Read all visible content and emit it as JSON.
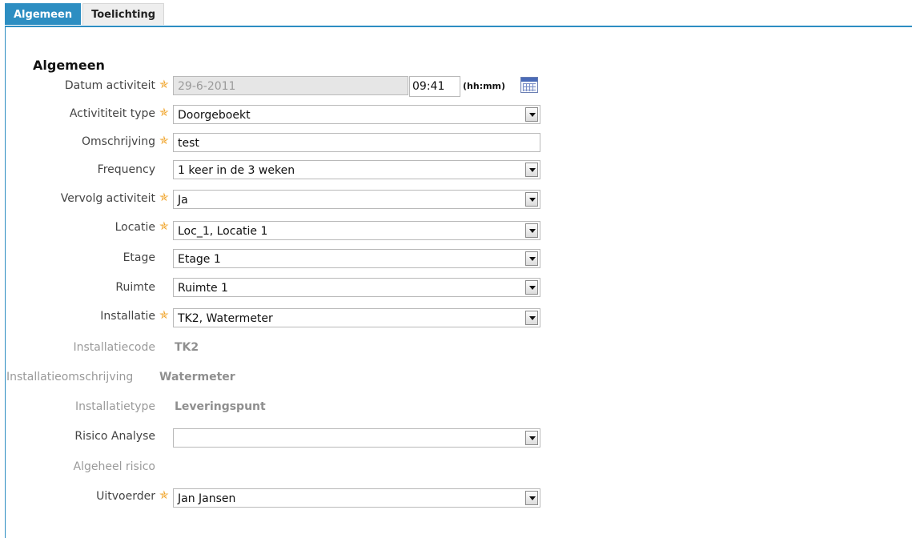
{
  "tabs": [
    {
      "label": "Algemeen",
      "active": true
    },
    {
      "label": "Toelichting",
      "active": false
    }
  ],
  "section_title": "Algemeen",
  "required_icon": "star-icon",
  "fields": {
    "datum": {
      "label": "Datum activiteit",
      "value": "29-6-2011",
      "time": "09:41",
      "time_hint": "(hh:mm)",
      "calendar_icon": "calendar-icon"
    },
    "type": {
      "label": "Activititeit type",
      "value": "Doorgeboekt"
    },
    "omschrijving": {
      "label": "Omschrijving",
      "value": "test"
    },
    "frequency": {
      "label": "Frequency",
      "value": "1 keer in de 3 weken"
    },
    "vervolg": {
      "label": "Vervolg activiteit",
      "value": "Ja"
    },
    "locatie": {
      "label": "Locatie",
      "value": "Loc_1, Locatie 1"
    },
    "etage": {
      "label": "Etage",
      "value": "Etage 1"
    },
    "ruimte": {
      "label": "Ruimte",
      "value": "Ruimte 1"
    },
    "installatie": {
      "label": "Installatie",
      "value": "TK2, Watermeter"
    },
    "installatiecode": {
      "label": "Installatiecode",
      "value": "TK2"
    },
    "installatieomschrijving": {
      "label": "Installatieomschrijving",
      "value": "Watermeter"
    },
    "installatietype": {
      "label": "Installatietype",
      "value": "Leveringspunt"
    },
    "risico": {
      "label": "Risico Analyse",
      "value": ""
    },
    "algeheel": {
      "label": "Algeheel risico",
      "value": ""
    },
    "uitvoerder": {
      "label": "Uitvoerder",
      "value": "Jan Jansen"
    }
  },
  "colors": {
    "accent": "#2d8ec2",
    "required_star": "#f0a020"
  }
}
